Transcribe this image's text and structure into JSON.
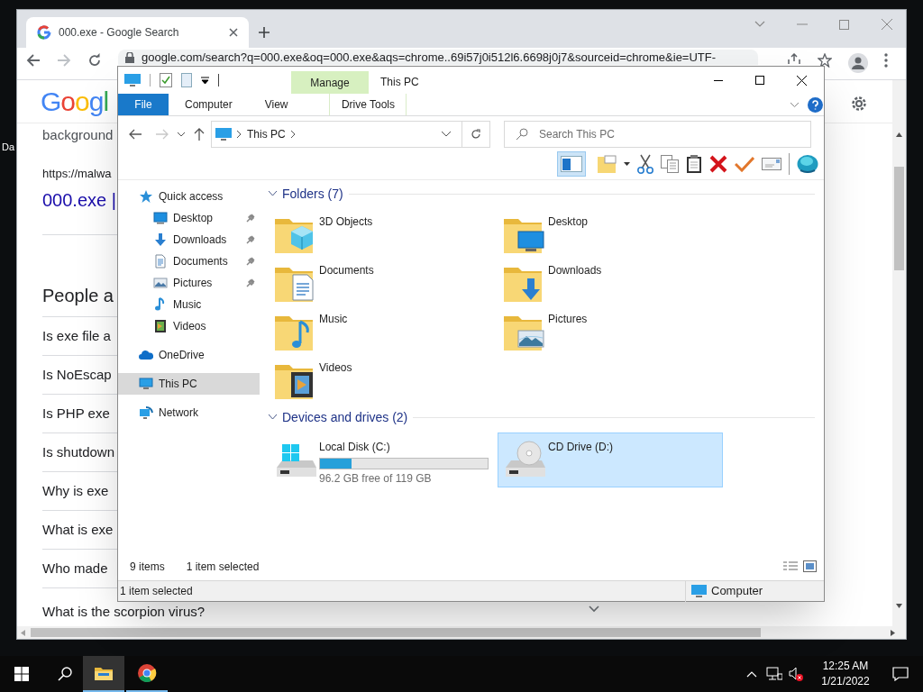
{
  "desktop": {
    "icon_label": "Da"
  },
  "browser": {
    "tab_title": "000.exe - Google Search",
    "address": "google.com/search?q=000.exe&oq=000.exe&aqs=chrome..69i57j0i512l6.6698j0j7&sourceid=chrome&ie=UTF-",
    "page": {
      "logo": "Googl",
      "snippet": "background",
      "url": "https://malwa",
      "result_title": "000.exe |",
      "section_heading": "People a",
      "questions": [
        "Is exe file a",
        "Is NoEscap",
        "Is PHP exe",
        "Is shutdown",
        "Why is exe",
        "What is exe",
        "Who made",
        "What is the scorpion virus?"
      ]
    }
  },
  "explorer": {
    "title": "This PC",
    "context_tab": "Manage",
    "ribbon_tabs": [
      {
        "label": "File",
        "kind": "file"
      },
      {
        "label": "Computer",
        "kind": "tab"
      },
      {
        "label": "View",
        "kind": "tab"
      },
      {
        "label": "Drive Tools",
        "kind": "context"
      }
    ],
    "breadcrumbs": [
      "This PC"
    ],
    "search": {
      "placeholder": "Search This PC"
    },
    "nav": [
      {
        "label": "Quick access",
        "kind": "star",
        "selected": false,
        "children": [
          {
            "label": "Desktop",
            "kind": "desktop",
            "pinned": true,
            "selected": false
          },
          {
            "label": "Downloads",
            "kind": "downloads",
            "pinned": true,
            "selected": false
          },
          {
            "label": "Documents",
            "kind": "documents",
            "pinned": true,
            "selected": false
          },
          {
            "label": "Pictures",
            "kind": "pictures",
            "pinned": true,
            "selected": false
          },
          {
            "label": "Music",
            "kind": "music",
            "pinned": false,
            "selected": false
          },
          {
            "label": "Videos",
            "kind": "videos",
            "pinned": false,
            "selected": false
          }
        ]
      },
      {
        "label": "OneDrive",
        "kind": "cloud",
        "selected": false
      },
      {
        "label": "This PC",
        "kind": "pc",
        "selected": true
      },
      {
        "label": "Network",
        "kind": "network",
        "selected": false
      }
    ],
    "groups": [
      {
        "header": "Folders (7)",
        "expanded": true,
        "items": [
          {
            "name": "3D Objects",
            "kind": "objects"
          },
          {
            "name": "Desktop",
            "kind": "desktop"
          },
          {
            "name": "Documents",
            "kind": "documents"
          },
          {
            "name": "Downloads",
            "kind": "downloads"
          },
          {
            "name": "Music",
            "kind": "music"
          },
          {
            "name": "Pictures",
            "kind": "pictures"
          },
          {
            "name": "Videos",
            "kind": "videos"
          }
        ]
      },
      {
        "header": "Devices and drives (2)",
        "expanded": true,
        "items": [
          {
            "name": "Local Disk (C:)",
            "kind": "disk",
            "level": 0.19,
            "free": "96.2 GB free of 119 GB",
            "selected": false
          },
          {
            "name": "CD Drive (D:)",
            "kind": "cd",
            "selected": true
          }
        ]
      }
    ],
    "item_count": "9 items",
    "selection_count": "1 item selected",
    "status_bar": {
      "text": "1 item selected",
      "zone": "Computer"
    }
  },
  "taskbar": {
    "apps": [
      {
        "kind": "explorer",
        "active": true
      },
      {
        "kind": "chrome",
        "active": false
      }
    ],
    "time": "12:25 AM",
    "date": "1/21/2022"
  }
}
